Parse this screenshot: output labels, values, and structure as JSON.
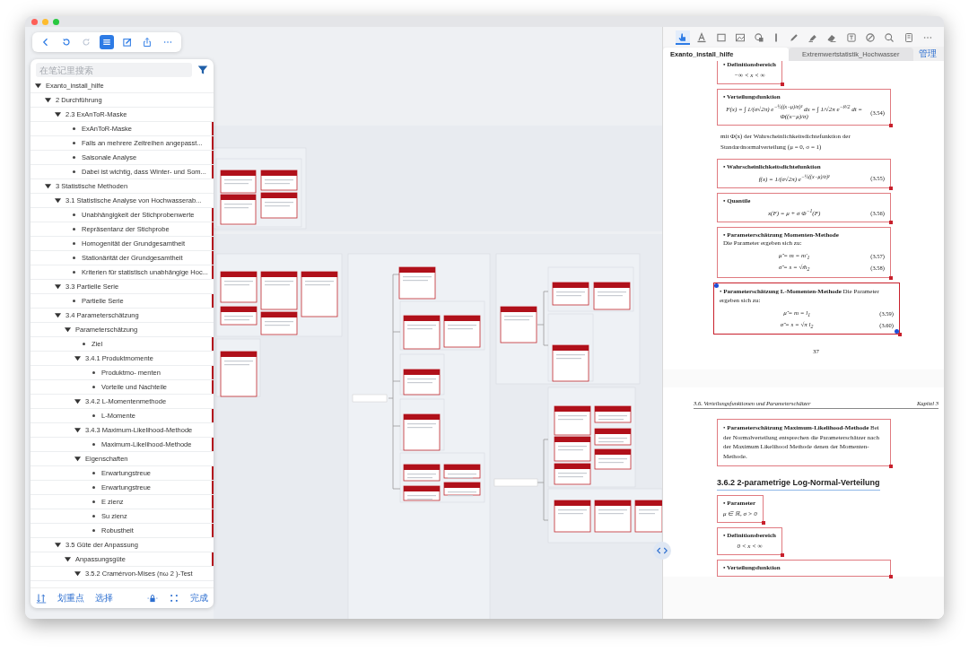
{
  "left_toolbar": [
    {
      "kind": "back",
      "selected": false,
      "disabled": false
    },
    {
      "kind": "undo",
      "selected": false,
      "disabled": false
    },
    {
      "kind": "redo",
      "selected": false,
      "disabled": true
    },
    {
      "kind": "outline",
      "selected": true,
      "disabled": false
    },
    {
      "kind": "edit",
      "selected": false,
      "disabled": false
    },
    {
      "kind": "share",
      "selected": false,
      "disabled": false
    },
    {
      "kind": "more",
      "selected": false,
      "disabled": false
    }
  ],
  "outline": {
    "search": {
      "placeholder": "在笔记里搜索"
    },
    "items": [
      {
        "kind": "group",
        "label": "Exanto_install_hilfe",
        "expanded": true,
        "marked": false,
        "children": [
          {
            "kind": "group",
            "label": "2  Durchführung",
            "expanded": true,
            "marked": false,
            "children": [
              {
                "kind": "group",
                "label": "2.3 ExAnToR-Maske",
                "expanded": true,
                "marked": false,
                "children": [
                  {
                    "kind": "leaf",
                    "label": "ExAnToR-Maske",
                    "marked": true
                  },
                  {
                    "kind": "leaf",
                    "label": "Falls an mehrere Zeitreihen angepasst...",
                    "marked": true
                  },
                  {
                    "kind": "leaf",
                    "label": "Saisonale Analyse",
                    "marked": true
                  },
                  {
                    "kind": "leaf",
                    "label": "Dabei ist wichtig, dass Winter- und Som...",
                    "marked": true
                  }
                ]
              }
            ]
          },
          {
            "kind": "group",
            "label": "3  Statistische Methoden",
            "expanded": true,
            "marked": false,
            "children": [
              {
                "kind": "group",
                "label": "3.1 Statistische Analyse von Hochwasserab...",
                "expanded": true,
                "marked": false,
                "children": [
                  {
                    "kind": "leaf",
                    "label": "Unabhängigkeit der Stichprobenwerte",
                    "marked": true
                  },
                  {
                    "kind": "leaf",
                    "label": "Repräsentanz der Stichprobe",
                    "marked": true
                  },
                  {
                    "kind": "leaf",
                    "label": "Homogenität der Grundgesamtheit",
                    "marked": true
                  },
                  {
                    "kind": "leaf",
                    "label": "Stationärität der Grundgesamtheit",
                    "marked": true
                  },
                  {
                    "kind": "leaf",
                    "label": "Kriterien für statistisch unabhängige Hoc...",
                    "marked": true
                  }
                ]
              },
              {
                "kind": "group",
                "label": "3.3 Partielle Serie",
                "expanded": true,
                "marked": false,
                "children": [
                  {
                    "kind": "leaf",
                    "label": "Partielle Serie",
                    "marked": true
                  }
                ]
              },
              {
                "kind": "group",
                "label": "3.4 Parameterschätzung",
                "expanded": true,
                "marked": false,
                "children": [
                  {
                    "kind": "group",
                    "label": "Parameterschätzung",
                    "expanded": true,
                    "marked": false,
                    "children": [
                      {
                        "kind": "leaf",
                        "label": "Ziel",
                        "marked": true
                      },
                      {
                        "kind": "group",
                        "label": "3.4.1 Produktmomente",
                        "expanded": true,
                        "marked": false,
                        "children": [
                          {
                            "kind": "leaf",
                            "label": "Produktmo- menten",
                            "marked": true
                          },
                          {
                            "kind": "leaf",
                            "label": "Vorteile und Nachteile",
                            "marked": true
                          }
                        ]
                      },
                      {
                        "kind": "group",
                        "label": "3.4.2 L-Momentenmethode",
                        "expanded": true,
                        "marked": false,
                        "children": [
                          {
                            "kind": "leaf",
                            "label": "L-Momente",
                            "marked": true
                          }
                        ]
                      },
                      {
                        "kind": "group",
                        "label": "3.4.3 Maximum-Likelihood-Methode",
                        "expanded": true,
                        "marked": false,
                        "children": [
                          {
                            "kind": "leaf",
                            "label": "Maximum-Likelihood-Methode",
                            "marked": true
                          }
                        ]
                      },
                      {
                        "kind": "group",
                        "label": "Eigenschaften",
                        "expanded": true,
                        "marked": false,
                        "children": [
                          {
                            "kind": "leaf",
                            "label": "Erwartungstreue",
                            "marked": true
                          },
                          {
                            "kind": "leaf",
                            "label": "Erwartungstreue",
                            "marked": true
                          },
                          {
                            "kind": "leaf",
                            "label": "E zienz",
                            "marked": true
                          },
                          {
                            "kind": "leaf",
                            "label": "Su zienz",
                            "marked": true
                          },
                          {
                            "kind": "leaf",
                            "label": "Robustheit",
                            "marked": true
                          }
                        ]
                      }
                    ]
                  }
                ]
              },
              {
                "kind": "group",
                "label": "3.5 Güte der Anpassung",
                "expanded": true,
                "marked": false,
                "children": [
                  {
                    "kind": "group",
                    "label": "Anpassungsgüte",
                    "expanded": true,
                    "marked": true,
                    "children": [
                      {
                        "kind": "group",
                        "label": "3.5.2 Cramérvon-Mises (nω 2 )-Test",
                        "expanded": true,
                        "marked": false
                      }
                    ]
                  }
                ]
              }
            ]
          }
        ]
      }
    ],
    "bottom_bar": [
      {
        "kind": "sort"
      },
      {
        "kind": "text",
        "label": "划重点"
      },
      {
        "kind": "text",
        "label": "选择"
      },
      {
        "kind": "lock"
      },
      {
        "kind": "grid"
      },
      {
        "kind": "text",
        "label": "完成"
      }
    ]
  },
  "pdf_toolbar": [
    {
      "kind": "hand",
      "selected": true
    },
    {
      "kind": "highlight",
      "selected": false
    },
    {
      "kind": "rect",
      "selected": false
    },
    {
      "kind": "image",
      "selected": false
    },
    {
      "kind": "shape",
      "selected": false
    },
    {
      "kind": "divider"
    },
    {
      "kind": "pen",
      "selected": false
    },
    {
      "kind": "marker",
      "selected": false
    },
    {
      "kind": "eraser",
      "selected": false
    },
    {
      "kind": "textbox",
      "selected": false
    },
    {
      "kind": "forbid",
      "selected": false
    },
    {
      "kind": "search",
      "selected": false
    },
    {
      "kind": "bookmark",
      "selected": false
    },
    {
      "kind": "more",
      "selected": false
    }
  ],
  "pdf_tabs": [
    {
      "label": "Exanto_install_hilfe",
      "selected": true
    },
    {
      "label": "Extremwertstatistik_Hochwasser",
      "selected": false
    }
  ],
  "pdf_manage": "管理",
  "pdf_pages": [
    {
      "blocks": [
        {
          "kind": "box",
          "cut": true,
          "selected": false,
          "title": "• Definitionsbereich",
          "formulas": [
            {
              "expr": "−∞ < x < ∞"
            }
          ]
        },
        {
          "kind": "box",
          "cut": false,
          "selected": false,
          "title": "• Verteilungsfunktion",
          "formulas": [
            {
              "expr": "F(x) = ∫ 1/(σ√2π) e$^{−½((x−μ)/σ)²}$ dx = ∫ 1/√2π e$^{−t²/2}$ dt = Φ((x−μ)/σ)",
              "number": "(3.54)"
            }
          ]
        },
        {
          "kind": "text",
          "text": "mit Φ(x) der Wahrscheinlichkeitsdichtefunktion der Standardnormalverteilung (μ = 0, σ = 1)"
        },
        {
          "kind": "box",
          "cut": false,
          "selected": false,
          "title": "• Wahrscheinlichkeitsdichtefunktion",
          "formulas": [
            {
              "expr": "f(x) = 1/(σ√2π) e$^{−½((x−μ)/σ)²}$",
              "number": "(3.55)"
            }
          ]
        },
        {
          "kind": "box",
          "cut": false,
          "selected": false,
          "title": "• Quantile",
          "formulas": [
            {
              "expr": "x(F) = μ + σ Φ$^{−1}$(F)",
              "number": "(3.56)"
            }
          ]
        },
        {
          "kind": "box",
          "cut": false,
          "selected": false,
          "title": "• Parameterschätzung Momenten-Methode",
          "body": "Die Parameter ergeben sich zu:",
          "formulas": [
            {
              "expr": "μ̂ = m = m'$_{1}$",
              "number": "(3.57)"
            },
            {
              "expr": "σ̂ = s = √m̂$_{2}$",
              "number": "(3.58)"
            }
          ]
        },
        {
          "kind": "box",
          "cut": false,
          "selected": true,
          "text": "• **Parameterschätzung L-Momenten-Methode** Die Parameter ergeben sich zu:",
          "formulas": [
            {
              "expr": "μ̂ = m = l$_{1}$",
              "number": "(3.59)"
            },
            {
              "expr": "σ̂ = s = √π l$_{2}$",
              "number": "(3.60)"
            }
          ]
        }
      ],
      "page_number": "37"
    },
    {
      "header": {
        "left": "3.6.  Verteilungsfunktionen und Parameterschätzer",
        "right": "Kapitel 3"
      },
      "blocks": [
        {
          "kind": "box",
          "cut": false,
          "selected": false,
          "text": "• **Parameterschätzung Maximum-Likelihood-Methode** Bei der Normalverteilung entsprechen die Parameterschätzer nach der Maximum Likelihood Methode denen der Momenten-Methode."
        },
        {
          "kind": "heading",
          "text": "3.6.2  2-parametrige Log-Normal-Verteilung"
        },
        {
          "kind": "box",
          "cut": false,
          "selected": false,
          "title": "• Parameter",
          "formulas": [
            {
              "expr": "μ ∈ ℝ, σ > 0"
            }
          ]
        },
        {
          "kind": "box",
          "cut": false,
          "selected": false,
          "title": "• Definitionsbereich",
          "formulas": [
            {
              "expr": "0 < x < ∞"
            }
          ]
        },
        {
          "kind": "box",
          "cut": false,
          "selected": false,
          "title": "• Verteilungsfunktion"
        }
      ]
    }
  ]
}
